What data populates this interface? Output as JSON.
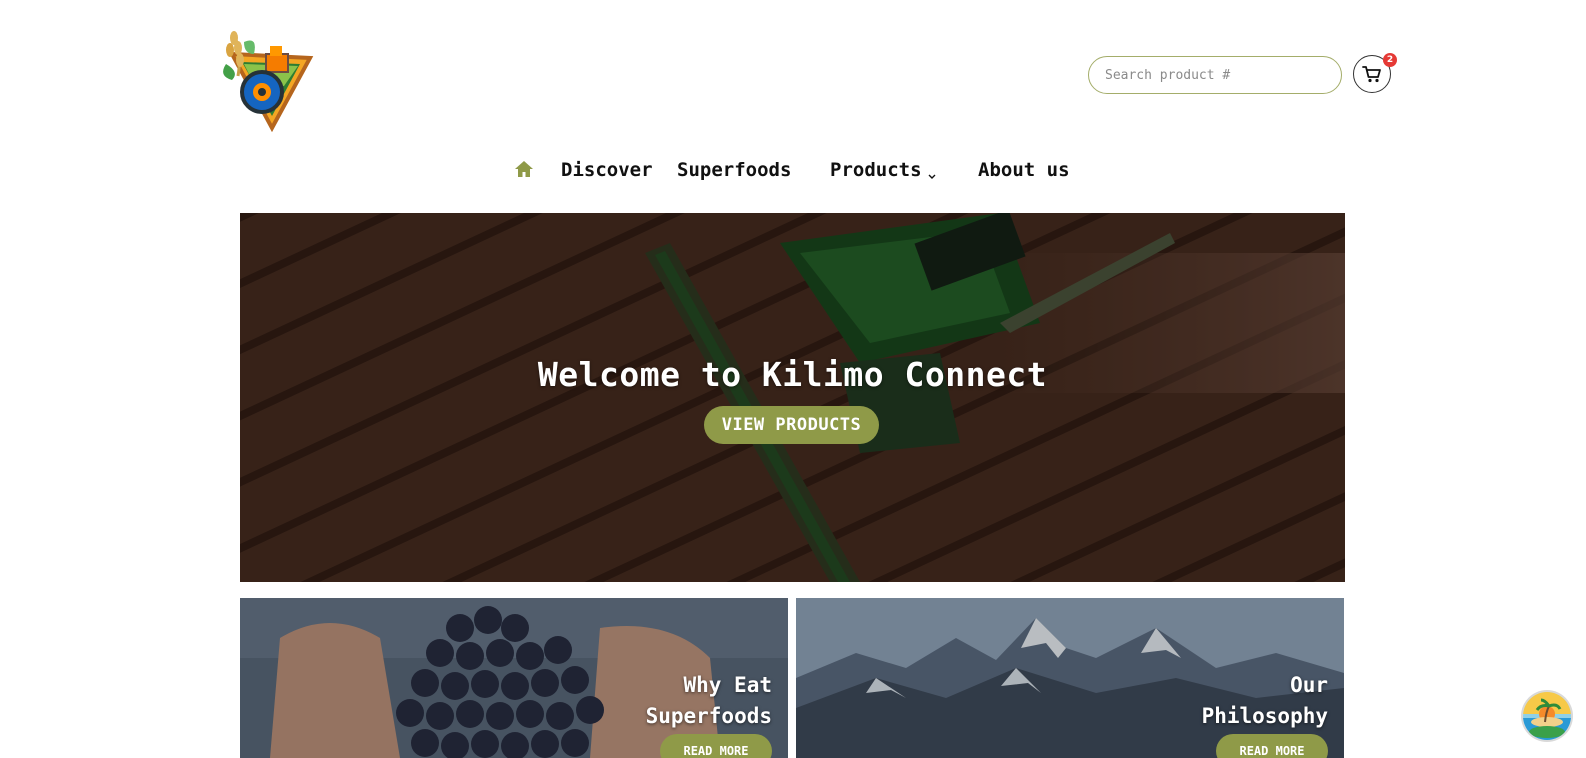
{
  "header": {
    "logo_icon": "tractor-wheat-logo-icon",
    "search": {
      "placeholder": "Search product #",
      "value": ""
    },
    "cart": {
      "icon": "cart-icon",
      "badge_count": "2"
    }
  },
  "nav": {
    "home_icon": "home-icon",
    "items": [
      {
        "label": "Discover"
      },
      {
        "label": "Superfoods"
      },
      {
        "label": "Products"
      },
      {
        "label": "About us"
      }
    ],
    "accent_color": "#8f9a48"
  },
  "hero": {
    "title": "Welcome to Kilimo Connect",
    "button_label": "VIEW PRODUCTS"
  },
  "cards": [
    {
      "title_line1": "Why Eat",
      "title_line2": "Superfoods",
      "button_label": "READ MORE"
    },
    {
      "title_line1": "Our",
      "title_line2": "Philosophy",
      "button_label": "READ MORE"
    }
  ],
  "floating_button": {
    "icon": "island-sunset-icon"
  },
  "colors": {
    "accent": "#8f9a48",
    "badge": "#e53935",
    "search_border": "#a4ad6a"
  }
}
